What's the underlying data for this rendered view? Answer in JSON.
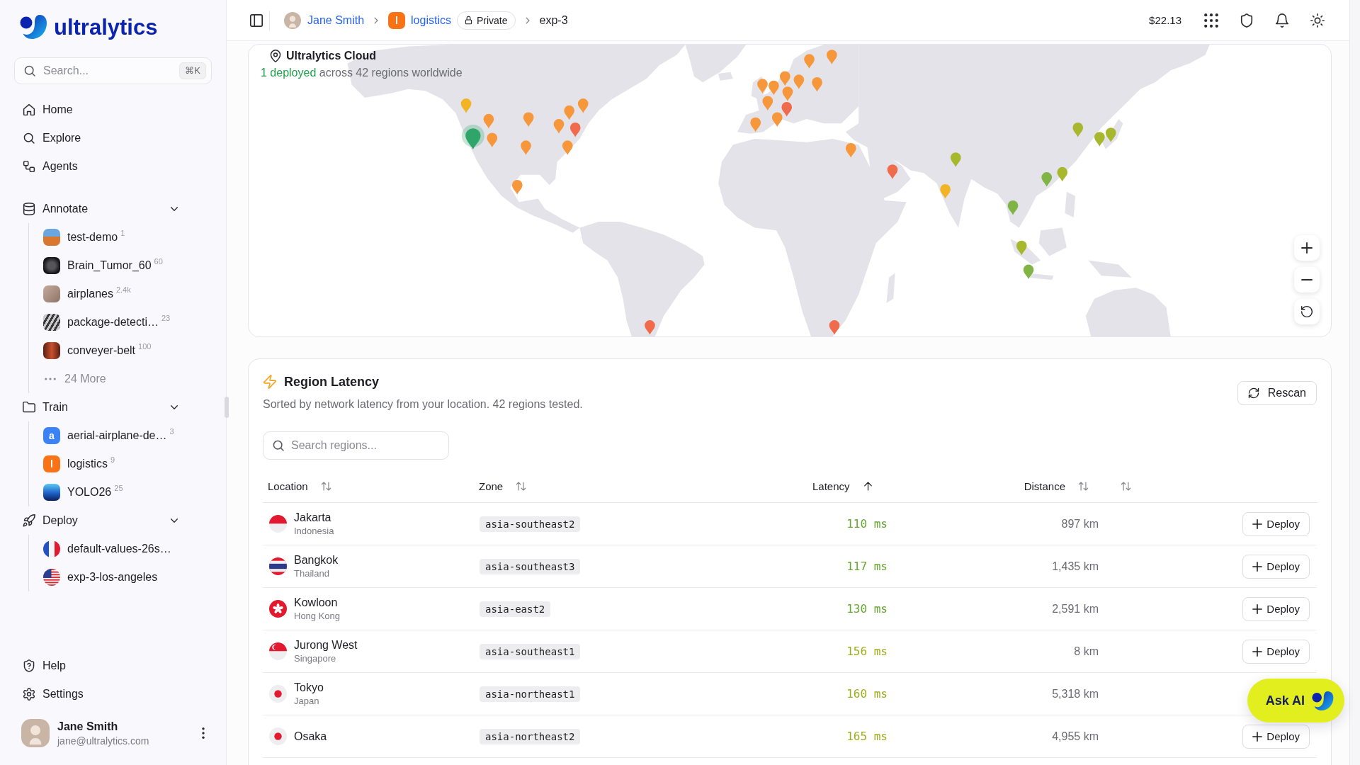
{
  "sidebar": {
    "logo": "ultralytics",
    "search": {
      "placeholder": "Search...",
      "shortcut": "⌘K"
    },
    "nav": [
      {
        "label": "Home"
      },
      {
        "label": "Explore"
      },
      {
        "label": "Agents"
      }
    ],
    "sections": [
      {
        "label": "Annotate",
        "expanded": true,
        "items": [
          {
            "label": "test-demo",
            "count": "1",
            "kind": "photo"
          },
          {
            "label": "Brain_Tumor_60",
            "count": "60",
            "kind": "photo"
          },
          {
            "label": "airplanes",
            "count": "2.4k",
            "kind": "photo"
          },
          {
            "label": "package-detecti…",
            "count": "23",
            "kind": "photo"
          },
          {
            "label": "conveyer-belt",
            "count": "100",
            "kind": "photo"
          }
        ],
        "more": "24 More"
      },
      {
        "label": "Train",
        "expanded": true,
        "items": [
          {
            "label": "aerial-airplane-de…",
            "count": "3",
            "kind": "letter",
            "letter": "a",
            "color": "#3b82f6"
          },
          {
            "label": "logistics",
            "count": "9",
            "kind": "letter",
            "letter": "l",
            "color": "#f97316"
          },
          {
            "label": "YOLO26",
            "count": "25",
            "kind": "photo"
          }
        ]
      },
      {
        "label": "Deploy",
        "expanded": true,
        "items": [
          {
            "label": "default-values-26s…",
            "kind": "flag"
          },
          {
            "label": "exp-3-los-angeles",
            "kind": "flag"
          }
        ]
      }
    ],
    "footer": [
      {
        "label": "Help"
      },
      {
        "label": "Settings"
      }
    ],
    "user": {
      "name": "Jane Smith",
      "email": "jane@ultralytics.com"
    }
  },
  "topbar": {
    "breadcrumb": [
      {
        "kind": "user",
        "label": "Jane Smith"
      },
      {
        "kind": "project",
        "label": "logistics",
        "letter": "l",
        "color": "#f97316",
        "badge": "Private"
      },
      {
        "kind": "page",
        "label": "exp-3"
      }
    ],
    "balance": "$22.13"
  },
  "cloud": {
    "title": "Ultralytics Cloud",
    "highlight": "1 deployed",
    "summary": "across 42 regions worldwide",
    "pins": [
      {
        "color": "#f2b424",
        "deployed": false
      },
      {
        "color": "#f5973a",
        "deployed": false
      },
      {
        "color": "#2fa56a",
        "deployed": true
      },
      {
        "color": "#f5973a",
        "deployed": false
      },
      {
        "color": "#f5973a",
        "deployed": false
      },
      {
        "color": "#f5973a",
        "deployed": false
      },
      {
        "color": "#f5973a",
        "deployed": false
      },
      {
        "color": "#f5973a",
        "deployed": false
      },
      {
        "color": "#f5973a",
        "deployed": false
      },
      {
        "color": "#f5973a",
        "deployed": false
      },
      {
        "color": "#ef6b4b",
        "deployed": false
      },
      {
        "color": "#f5973a",
        "deployed": false
      },
      {
        "color": "#ef6b4b",
        "deployed": false
      },
      {
        "color": "#f5973a",
        "deployed": false
      },
      {
        "color": "#f5973a",
        "deployed": false
      },
      {
        "color": "#f5973a",
        "deployed": false
      },
      {
        "color": "#f5973a",
        "deployed": false
      },
      {
        "color": "#f5973a",
        "deployed": false
      },
      {
        "color": "#f5973a",
        "deployed": false
      },
      {
        "color": "#f5973a",
        "deployed": false
      },
      {
        "color": "#f5973a",
        "deployed": false
      },
      {
        "color": "#f5973a",
        "deployed": false
      },
      {
        "color": "#ef6b4b",
        "deployed": false
      },
      {
        "color": "#f5973a",
        "deployed": false
      },
      {
        "color": "#f5973a",
        "deployed": false
      },
      {
        "color": "#f5973a",
        "deployed": false
      },
      {
        "color": "#ef6b4b",
        "deployed": false
      },
      {
        "color": "#ef6b4b",
        "deployed": false
      },
      {
        "color": "#a8b82e",
        "deployed": false
      },
      {
        "color": "#f2b424",
        "deployed": false
      },
      {
        "color": "#80b444",
        "deployed": false
      },
      {
        "color": "#80b444",
        "deployed": false
      },
      {
        "color": "#a8b82e",
        "deployed": false
      },
      {
        "color": "#a8b82e",
        "deployed": false
      },
      {
        "color": "#a8b82e",
        "deployed": false
      },
      {
        "color": "#a8b82e",
        "deployed": false
      },
      {
        "color": "#a8b82e",
        "deployed": false
      },
      {
        "color": "#80b444",
        "deployed": false
      }
    ]
  },
  "latency": {
    "title": "Region Latency",
    "subtitle": "Sorted by network latency from your location. 42 regions tested.",
    "rescan": "Rescan",
    "search_placeholder": "Search regions...",
    "columns": [
      {
        "label": "Location",
        "sorted": false
      },
      {
        "label": "Zone",
        "sorted": false
      },
      {
        "label": "Latency",
        "sorted": true
      },
      {
        "label": "Distance",
        "sorted": false
      },
      {
        "sorted": false
      }
    ],
    "rows": [
      {
        "city": "Jakarta",
        "country": "Indonesia",
        "zone": "asia-southeast2",
        "latency": "110 ms",
        "color": "#66a832",
        "distance": "897 km",
        "action": "Deploy"
      },
      {
        "city": "Bangkok",
        "country": "Thailand",
        "zone": "asia-southeast3",
        "latency": "117 ms",
        "color": "#66a832",
        "distance": "1,435 km",
        "action": "Deploy"
      },
      {
        "city": "Kowloon",
        "country": "Hong Kong",
        "zone": "asia-east2",
        "latency": "130 ms",
        "color": "#66a832",
        "distance": "2,591 km",
        "action": "Deploy"
      },
      {
        "city": "Jurong West",
        "country": "Singapore",
        "zone": "asia-southeast1",
        "latency": "156 ms",
        "color": "#9fae1c",
        "distance": "8 km",
        "action": "Deploy"
      },
      {
        "city": "Tokyo",
        "country": "Japan",
        "zone": "asia-northeast1",
        "latency": "160 ms",
        "color": "#9fae1c",
        "distance": "5,318 km"
      },
      {
        "city": "Osaka",
        "zone": "asia-northeast2",
        "latency": "165 ms",
        "color": "#9fae1c",
        "distance": "4,955 km",
        "action": "Deploy"
      }
    ]
  },
  "ask_ai": {
    "label": "Ask AI"
  }
}
